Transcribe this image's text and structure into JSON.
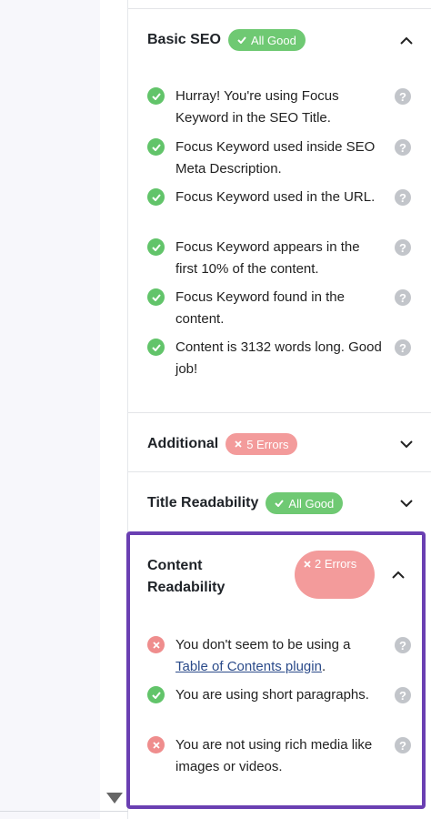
{
  "sections": {
    "basic_seo": {
      "title": "Basic SEO",
      "badge": "All Good",
      "items": [
        {
          "status": "pass",
          "text": "Hurray! You're using Focus Keyword in the SEO Title."
        },
        {
          "status": "pass",
          "text": "Focus Keyword used inside SEO Meta Description."
        },
        {
          "status": "pass",
          "text": "Focus Keyword used in the URL."
        },
        {
          "status": "pass",
          "text": "Focus Keyword appears in the first 10% of the content."
        },
        {
          "status": "pass",
          "text": "Focus Keyword found in the content."
        },
        {
          "status": "pass",
          "text": "Content is 3132 words long. Good job!"
        }
      ]
    },
    "additional": {
      "title": "Additional",
      "badge": "5 Errors"
    },
    "title_readability": {
      "title": "Title Readability",
      "badge": "All Good"
    },
    "content_readability": {
      "title": "Content Readability",
      "badge": "2 Errors",
      "items": [
        {
          "status": "fail",
          "text_before": "You don't seem to be using a ",
          "link": "Table of Contents plugin",
          "text_after": "."
        },
        {
          "status": "pass",
          "text": "You are using short paragraphs."
        },
        {
          "status": "fail",
          "text": "You are not using rich media like images or videos."
        }
      ]
    }
  },
  "icons": {
    "pass": "check-circle-icon",
    "fail": "x-circle-icon",
    "help": "question-circle-icon",
    "expanded": "chevron-up-icon",
    "collapsed": "chevron-down-icon"
  },
  "colors": {
    "good": "#6fc973",
    "error": "#f39b9b",
    "highlight": "#6a3fb2"
  },
  "help_glyph": "?"
}
